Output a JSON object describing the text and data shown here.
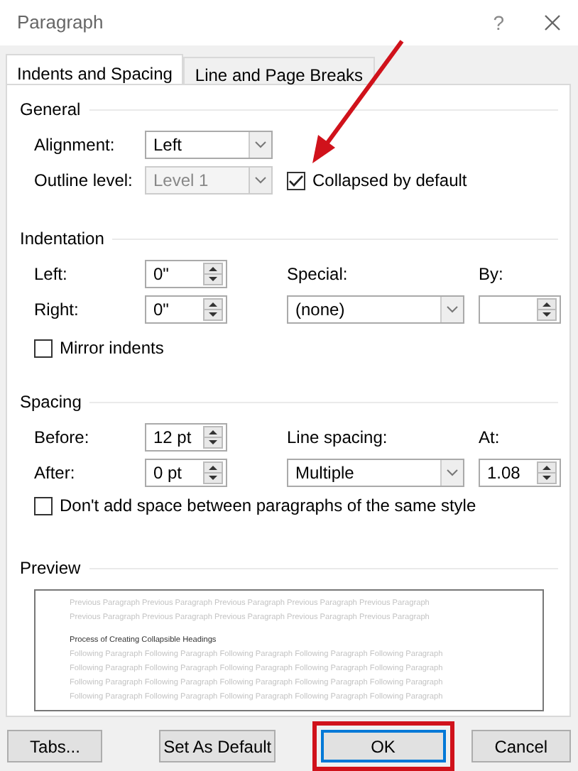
{
  "window": {
    "title": "Paragraph",
    "help": "?"
  },
  "tabs": [
    {
      "label": "Indents and Spacing",
      "selected": true
    },
    {
      "label": "Line and Page Breaks",
      "selected": false
    }
  ],
  "general": {
    "heading": "General",
    "alignment": {
      "label": "Alignment:",
      "value": "Left",
      "disabled": false
    },
    "outline_level": {
      "label": "Outline level:",
      "value": "Level 1",
      "disabled": true
    },
    "collapsed": {
      "label": "Collapsed by default",
      "checked": true
    }
  },
  "indentation": {
    "heading": "Indentation",
    "left": {
      "label": "Left:",
      "value": "0\""
    },
    "right": {
      "label": "Right:",
      "value": "0\""
    },
    "special": {
      "label": "Special:",
      "value": "(none)",
      "disabled": false
    },
    "by": {
      "label": "By:"
    },
    "mirror": {
      "label": "Mirror indents",
      "checked": false
    }
  },
  "spacing": {
    "heading": "Spacing",
    "before": {
      "label": "Before:",
      "value": "12 pt"
    },
    "after": {
      "label": "After:",
      "value": "0 pt"
    },
    "line_spacing": {
      "label": "Line spacing:",
      "value": "Multiple",
      "disabled": false
    },
    "at": {
      "label": "At:",
      "value": "1.08"
    },
    "no_space": {
      "label": "Don't add space between paragraphs of the same style",
      "checked": false
    }
  },
  "preview": {
    "heading": "Preview",
    "previous_lines": [
      "Previous Paragraph Previous Paragraph Previous Paragraph Previous Paragraph Previous Paragraph",
      "Previous Paragraph Previous Paragraph Previous Paragraph Previous Paragraph Previous Paragraph"
    ],
    "sample": "Process of Creating Collapsible Headings",
    "following_lines": [
      "Following Paragraph Following Paragraph Following Paragraph Following Paragraph Following Paragraph",
      "Following Paragraph Following Paragraph Following Paragraph Following Paragraph Following Paragraph",
      "Following Paragraph Following Paragraph Following Paragraph Following Paragraph Following Paragraph",
      "Following Paragraph Following Paragraph Following Paragraph Following Paragraph Following Paragraph"
    ]
  },
  "buttons": [
    {
      "label": "Tabs...",
      "default": false
    },
    {
      "label": "Set As Default",
      "default": false
    },
    {
      "label": "OK",
      "default": true
    },
    {
      "label": "Cancel",
      "default": false
    }
  ]
}
